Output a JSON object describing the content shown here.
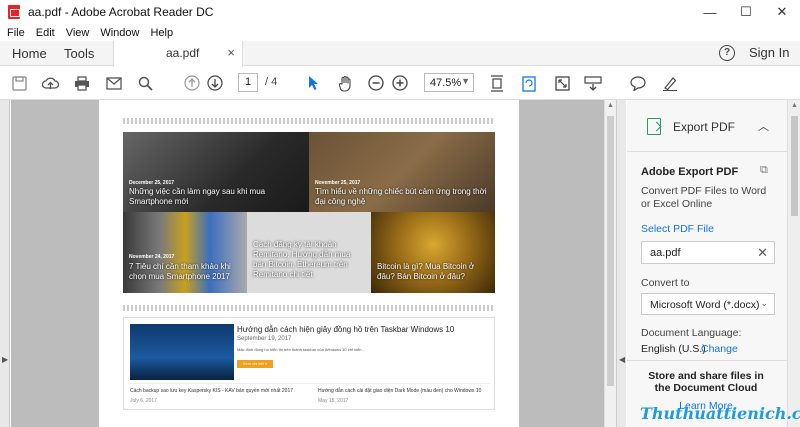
{
  "window": {
    "title": "aa.pdf - Adobe Acrobat Reader DC",
    "minimize": "—",
    "maximize": "☐",
    "close": "✕"
  },
  "menubar": [
    "File",
    "Edit",
    "View",
    "Window",
    "Help"
  ],
  "tabs": {
    "home": "Home",
    "tools": "Tools",
    "doc": "aa.pdf",
    "doc_close": "×"
  },
  "header": {
    "help": "?",
    "signin": "Sign In"
  },
  "toolbar": {
    "page_current": "1",
    "page_total": "/ 4",
    "zoom": "47.5%"
  },
  "document": {
    "tiles": [
      {
        "date": "December 25, 2017",
        "title": "Những việc cần làm ngay sau khi mua Smartphone mới"
      },
      {
        "date": "November 25, 2017",
        "title": "Tìm hiểu về những chiếc bút cảm ứng trong thời đại công nghệ"
      },
      {
        "date": "November 24, 2017",
        "title": "7 Tiêu chí cần tham khảo khi chọn mua Smartphone 2017"
      },
      {
        "date": "",
        "title": "Cách đăng ký tài khoản Remitano, Hướng dẫn mua bán Bitcoin, Ethereum trên Remitano chi tiết"
      },
      {
        "date": "",
        "title": "Bitcoin là gì? Mua Bitcoin ở đâu? Bán Bitcoin ở đâu?"
      }
    ],
    "article": {
      "title": "Hướng dẫn cách hiện giây đồng hồ trên Taskbar Windows 10",
      "date": "September 19, 2017",
      "excerpt": "Mặc định đồng hồ hiển thị trên thanh taskbar của Windows 10 chỉ hiển...",
      "button": "Xem chi tiết »",
      "related": [
        {
          "title": "Cách backup sao lưu key Kaspersky KIS - KAV bản quyền mới nhất 2017",
          "date": "July 6, 2017"
        },
        {
          "title": "Hướng dẫn cách cài đặt giao diện Dark Mode (màu đen) cho Windows 10",
          "date": "May 15, 2017"
        }
      ]
    }
  },
  "pane": {
    "header": "Export PDF",
    "section_title": "Adobe Export PDF",
    "description": "Convert PDF Files to Word or Excel Online",
    "select_file_label": "Select PDF File",
    "file_name": "aa.pdf",
    "convert_to_label": "Convert to",
    "convert_to_value": "Microsoft Word (*.docx)",
    "doc_lang_label": "Document Language:",
    "doc_lang_value": "English (U.S.)",
    "change_link": "Change",
    "store_text": "Store and share files in the Document Cloud",
    "learn_more": "Learn More"
  },
  "watermark": "Thuthuattienich.com"
}
